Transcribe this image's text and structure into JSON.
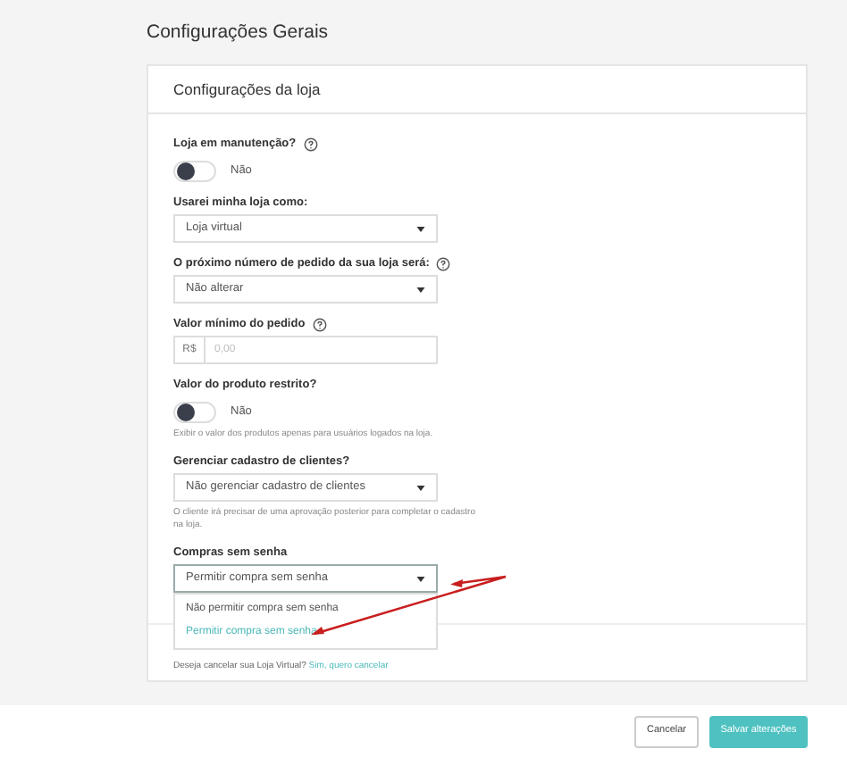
{
  "page_title": "Configurações Gerais",
  "card": {
    "title": "Configurações da loja",
    "fields": [
      {
        "kind": "toggle",
        "label": "Loja em manutenção?",
        "help": true,
        "on": false,
        "value_label": "Não"
      },
      {
        "kind": "select",
        "label": "Usarei minha loja como:",
        "help": false,
        "value": "Loja virtual"
      },
      {
        "kind": "select",
        "label": "O próximo número de pedido da sua loja será:",
        "help": true,
        "value": "Não alterar"
      },
      {
        "kind": "currency",
        "label": "Valor mínimo do pedido",
        "help": true,
        "prefix": "R$",
        "placeholder": "0,00"
      },
      {
        "kind": "toggle",
        "label": "Valor do produto restrito?",
        "help": false,
        "on": false,
        "value_label": "Não",
        "hint": "Exibir o valor dos produtos apenas para usuários logados na loja."
      },
      {
        "kind": "select",
        "label": "Gerenciar cadastro de clientes?",
        "help": false,
        "value": "Não gerenciar cadastro de clientes",
        "hint": "O cliente irá precisar de uma aprovação posterior para completar o cadastro na loja."
      },
      {
        "kind": "select",
        "label": "Compras sem senha",
        "help": false,
        "value": "Permitir compra sem senha",
        "open": true,
        "options": [
          {
            "label": "Não permitir compra sem senha",
            "selected": false
          },
          {
            "label": "Permitir compra sem senha",
            "selected": true
          }
        ]
      }
    ],
    "cancel_text": "Deseja cancelar sua Loja Virtual?",
    "cancel_link": "Sim, quero cancelar"
  },
  "buttons": [
    {
      "label": "Cancelar",
      "kind": "secondary"
    },
    {
      "label": "Salvar alterações",
      "kind": "primary"
    }
  ]
}
